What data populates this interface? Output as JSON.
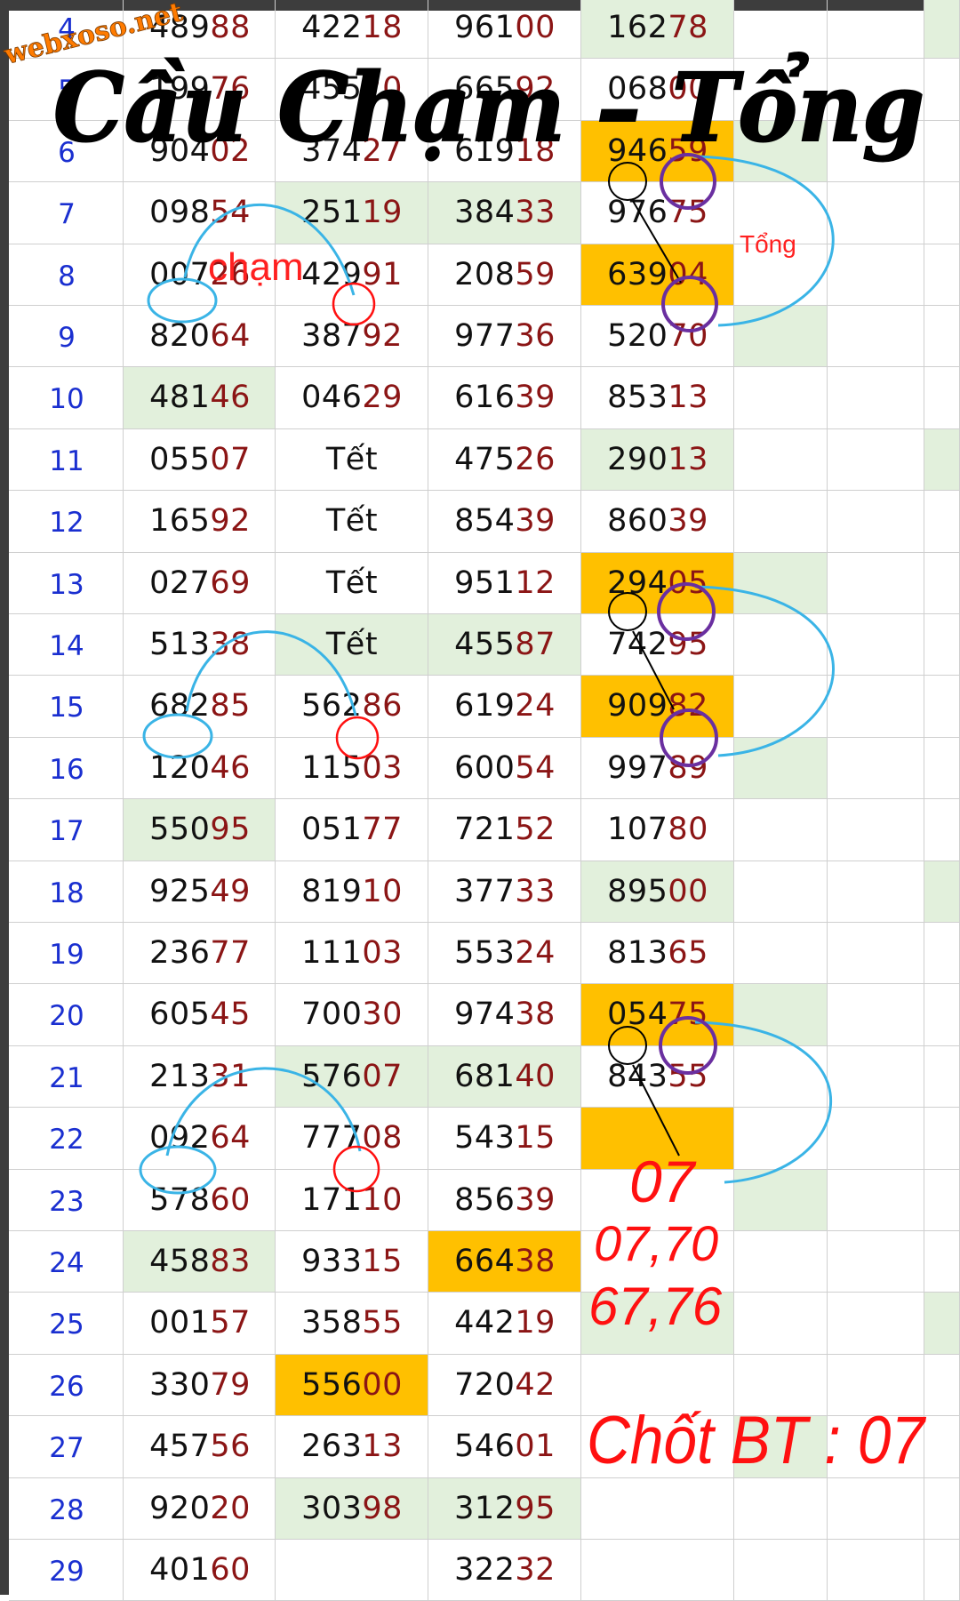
{
  "watermark": "webxoso.net",
  "title": "Cầu Chạm – Tổng",
  "labels": {
    "cham": "chạm",
    "tong": "Tổng"
  },
  "rows": [
    {
      "n": "4",
      "c": [
        "48988",
        "42218",
        "96100",
        "16278"
      ]
    },
    {
      "n": "5",
      "c": [
        "19976",
        "45520",
        "66592",
        "06800"
      ]
    },
    {
      "n": "6",
      "c": [
        "90402",
        "37427",
        "61918",
        "94659"
      ]
    },
    {
      "n": "7",
      "c": [
        "09854",
        "25119",
        "38433",
        "97675"
      ]
    },
    {
      "n": "8",
      "c": [
        "00726",
        "42991",
        "20859",
        "63904"
      ]
    },
    {
      "n": "9",
      "c": [
        "82064",
        "38792",
        "97736",
        "52070"
      ]
    },
    {
      "n": "10",
      "c": [
        "48146",
        "04629",
        "61639",
        "85313"
      ]
    },
    {
      "n": "11",
      "c": [
        "05507",
        "Tết",
        "47526",
        "29013"
      ]
    },
    {
      "n": "12",
      "c": [
        "16592",
        "Tết",
        "85439",
        "86039"
      ]
    },
    {
      "n": "13",
      "c": [
        "02769",
        "Tết",
        "95112",
        "29405"
      ]
    },
    {
      "n": "14",
      "c": [
        "51338",
        "Tết",
        "45587",
        "74295"
      ]
    },
    {
      "n": "15",
      "c": [
        "68285",
        "56286",
        "61924",
        "90982"
      ]
    },
    {
      "n": "16",
      "c": [
        "12046",
        "11503",
        "60054",
        "99789"
      ]
    },
    {
      "n": "17",
      "c": [
        "55095",
        "05177",
        "72152",
        "10780"
      ]
    },
    {
      "n": "18",
      "c": [
        "92549",
        "81910",
        "37733",
        "89500"
      ]
    },
    {
      "n": "19",
      "c": [
        "23677",
        "11103",
        "55324",
        "81365"
      ]
    },
    {
      "n": "20",
      "c": [
        "60545",
        "70030",
        "97438",
        "05475"
      ]
    },
    {
      "n": "21",
      "c": [
        "21331",
        "57607",
        "68140",
        "84355"
      ]
    },
    {
      "n": "22",
      "c": [
        "09264",
        "77708",
        "54315",
        ""
      ]
    },
    {
      "n": "23",
      "c": [
        "57860",
        "17110",
        "85639",
        ""
      ]
    },
    {
      "n": "24",
      "c": [
        "45883",
        "93315",
        "66438",
        ""
      ]
    },
    {
      "n": "25",
      "c": [
        "00157",
        "35855",
        "44219",
        ""
      ]
    },
    {
      "n": "26",
      "c": [
        "33079",
        "55600",
        "72042",
        ""
      ]
    },
    {
      "n": "27",
      "c": [
        "45756",
        "26313",
        "54601",
        ""
      ]
    },
    {
      "n": "28",
      "c": [
        "92020",
        "30398",
        "31295",
        ""
      ]
    },
    {
      "n": "29",
      "c": [
        "40160",
        "",
        "32232",
        ""
      ]
    }
  ],
  "prediction": {
    "main": "07",
    "pair1": "07,70",
    "pair2": "67,76",
    "final": "Chốt BT : 07"
  },
  "colors": {
    "green_cell": "#e2f0dc",
    "orange_cell": "#ffc000",
    "row_number": "#1a2fd0",
    "last_two": "#8b1515",
    "arc": "#3ab4e6",
    "ink_red": "#ff1010",
    "circle_purple": "#6a2fa0"
  }
}
